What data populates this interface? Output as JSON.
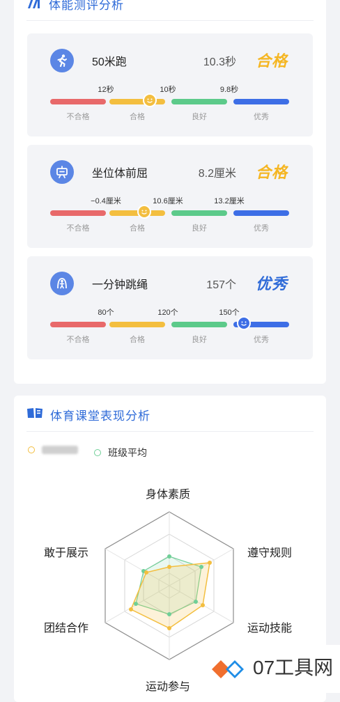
{
  "fitness": {
    "title": "体能测评分析",
    "items": [
      {
        "name": "50米跑",
        "value": "10.3秒",
        "grade": "合格",
        "icon": "running-icon",
        "thresholds": [
          "12秒",
          "10秒",
          "9.8秒"
        ],
        "levels": [
          "不合格",
          "合格",
          "良好",
          "优秀"
        ],
        "marker_level": "合格"
      },
      {
        "name": "坐位体前屈",
        "value": "8.2厘米",
        "grade": "合格",
        "icon": "sit-reach-icon",
        "thresholds": [
          "−0.4厘米",
          "10.6厘米",
          "13.2厘米"
        ],
        "levels": [
          "不合格",
          "合格",
          "良好",
          "优秀"
        ],
        "marker_level": "合格"
      },
      {
        "name": "一分钟跳绳",
        "value": "157个",
        "grade": "优秀",
        "icon": "jump-rope-icon",
        "thresholds": [
          "80个",
          "120个",
          "150个"
        ],
        "levels": [
          "不合格",
          "合格",
          "良好",
          "优秀"
        ],
        "marker_level": "优秀"
      }
    ]
  },
  "pe": {
    "title": "体育课堂表现分析",
    "legend": {
      "class_average": "班级平均"
    },
    "radar_labels": [
      "身体素质",
      "遵守规则",
      "运动技能",
      "运动参与",
      "团结合作",
      "敢于展示"
    ]
  },
  "watermark": {
    "text": "07工具网"
  },
  "colors": {
    "accent": "#2f6bd8",
    "fail": "#e8696a",
    "pass": "#f3be3f",
    "good": "#5cca8a",
    "excellent": "#3d6ee6",
    "pass_grade": "#f5b623",
    "excellent_grade": "#2f6bd8",
    "student_series": "#f3be3f",
    "average_series": "#6fcf97"
  }
}
